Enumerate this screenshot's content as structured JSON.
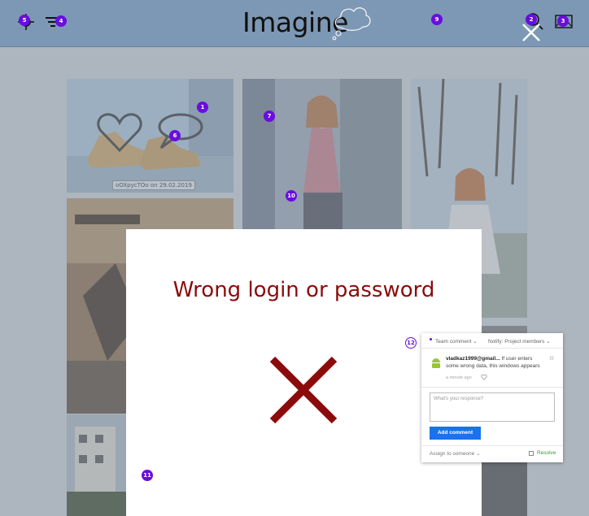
{
  "header": {
    "logo_text": "Imagine",
    "badges": {
      "filter": "4",
      "location": "5",
      "search": "2",
      "gallery": "3",
      "header_mid": "9"
    }
  },
  "gallery": {
    "caption": "oOXpycTOo on 29.02.2019",
    "badges": {
      "photo1": "1",
      "comment": "6",
      "photo2": "7",
      "photo2b": "10",
      "modal": "11"
    }
  },
  "modal": {
    "message": "Wrong login or password"
  },
  "comment_panel": {
    "badge": "12",
    "team_label": "Team comment",
    "notify_label": "Notify: Project members",
    "user": "vladkaz1999@gmail...",
    "text": " If user enters some wrong data, this windows appears",
    "time": "a minute ago",
    "input_placeholder": "What's your response?",
    "add_button": "Add comment",
    "assign_label": "Assign to someone",
    "resolve_label": "Resolve"
  },
  "colors": {
    "header_bg": "#7d98b4",
    "error_red": "#8b0b0b",
    "badge_purple": "#6a0dde",
    "button_blue": "#1a73e8"
  }
}
